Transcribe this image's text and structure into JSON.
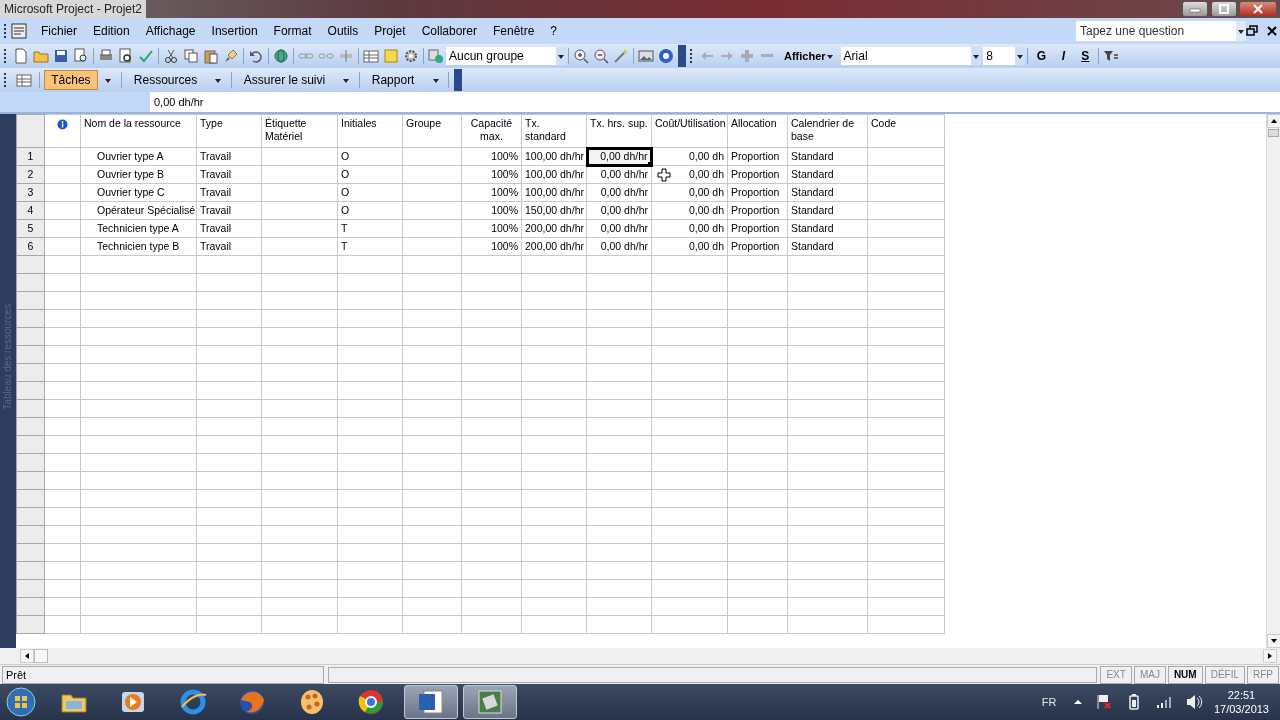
{
  "window": {
    "title": "Microsoft Project - Projet2"
  },
  "menu": [
    "Fichier",
    "Edition",
    "Affichage",
    "Insertion",
    "Format",
    "Outils",
    "Projet",
    "Collaborer",
    "Fenêtre",
    "?"
  ],
  "help_search": {
    "placeholder": "Tapez une question"
  },
  "toolbar": {
    "group_combo": "Aucun groupe",
    "show_menu": "Afficher",
    "font": "Arial",
    "font_size": "8",
    "format_buttons": [
      "G",
      "I",
      "S"
    ]
  },
  "view_bar": {
    "tabs": [
      {
        "label": "Tâches",
        "selected": true
      },
      {
        "label": "Ressources",
        "selected": false
      },
      {
        "label": "Assurer le suivi",
        "selected": false
      },
      {
        "label": "Rapport",
        "selected": false
      }
    ]
  },
  "entry_bar": {
    "value": "0,00 dh/hr"
  },
  "side_label": "Tableau des ressources",
  "table": {
    "columns": [
      {
        "kind": "icon"
      },
      {
        "kind": "text",
        "label": "Nom de la ressource"
      },
      {
        "kind": "text",
        "label": "Type"
      },
      {
        "kind": "text",
        "label": "Étiquette Matériel"
      },
      {
        "kind": "text",
        "label": "Initiales"
      },
      {
        "kind": "text",
        "label": "Groupe"
      },
      {
        "kind": "text",
        "label": "Capacité max."
      },
      {
        "kind": "text",
        "label": "Tx. standard"
      },
      {
        "kind": "text",
        "label": "Tx. hrs. sup."
      },
      {
        "kind": "text",
        "label": "Coût/Utilisation"
      },
      {
        "kind": "text",
        "label": "Allocation"
      },
      {
        "kind": "text",
        "label": "Calendrier de base"
      },
      {
        "kind": "text",
        "label": "Code"
      }
    ],
    "rows": [
      {
        "number": "1",
        "cells": [
          {
            "selected": false
          },
          {
            "text": "Ouvrier type A",
            "selected": false
          },
          {
            "text": "Travail",
            "selected": false
          },
          {
            "selected": false
          },
          {
            "text": "O",
            "selected": false
          },
          {
            "selected": false
          },
          {
            "text": "100%",
            "selected": false
          },
          {
            "text": "100,00 dh/hr",
            "selected": false
          },
          {
            "text": "0,00 dh/hr",
            "selected": true
          },
          {
            "text": "0,00 dh",
            "selected": false
          },
          {
            "text": "Proportion",
            "selected": false
          },
          {
            "text": "Standard",
            "selected": false
          },
          {
            "selected": false
          }
        ]
      },
      {
        "number": "2",
        "cells": [
          {
            "selected": false
          },
          {
            "text": "Ouvrier type B",
            "selected": false
          },
          {
            "text": "Travail",
            "selected": false
          },
          {
            "selected": false
          },
          {
            "text": "O",
            "selected": false
          },
          {
            "selected": false
          },
          {
            "text": "100%",
            "selected": false
          },
          {
            "text": "100,00 dh/hr",
            "selected": false
          },
          {
            "text": "0,00 dh/hr",
            "selected": false
          },
          {
            "text": "0,00 dh",
            "selected": false
          },
          {
            "text": "Proportion",
            "selected": false
          },
          {
            "text": "Standard",
            "selected": false
          },
          {
            "selected": false
          }
        ]
      },
      {
        "number": "3",
        "cells": [
          {
            "selected": false
          },
          {
            "text": "Ouvrier type C",
            "selected": false
          },
          {
            "text": "Travail",
            "selected": false
          },
          {
            "selected": false
          },
          {
            "text": "O",
            "selected": false
          },
          {
            "selected": false
          },
          {
            "text": "100%",
            "selected": false
          },
          {
            "text": "100,00 dh/hr",
            "selected": false
          },
          {
            "text": "0,00 dh/hr",
            "selected": false
          },
          {
            "text": "0,00 dh",
            "selected": false
          },
          {
            "text": "Proportion",
            "selected": false
          },
          {
            "text": "Standard",
            "selected": false
          },
          {
            "selected": false
          }
        ]
      },
      {
        "number": "4",
        "cells": [
          {
            "selected": false
          },
          {
            "text": "Opérateur Spécialisé",
            "selected": false
          },
          {
            "text": "Travail",
            "selected": false
          },
          {
            "selected": false
          },
          {
            "text": "O",
            "selected": false
          },
          {
            "selected": false
          },
          {
            "text": "100%",
            "selected": false
          },
          {
            "text": "150,00 dh/hr",
            "selected": false
          },
          {
            "text": "0,00 dh/hr",
            "selected": false
          },
          {
            "text": "0,00 dh",
            "selected": false
          },
          {
            "text": "Proportion",
            "selected": false
          },
          {
            "text": "Standard",
            "selected": false
          },
          {
            "selected": false
          }
        ]
      },
      {
        "number": "5",
        "cells": [
          {
            "selected": false
          },
          {
            "text": "Technicien type A",
            "selected": false
          },
          {
            "text": "Travail",
            "selected": false
          },
          {
            "selected": false
          },
          {
            "text": "T",
            "selected": false
          },
          {
            "selected": false
          },
          {
            "text": "100%",
            "selected": false
          },
          {
            "text": "200,00 dh/hr",
            "selected": false
          },
          {
            "text": "0,00 dh/hr",
            "selected": false
          },
          {
            "text": "0,00 dh",
            "selected": false
          },
          {
            "text": "Proportion",
            "selected": false
          },
          {
            "text": "Standard",
            "selected": false
          },
          {
            "selected": false
          }
        ]
      },
      {
        "number": "6",
        "cells": [
          {
            "selected": false
          },
          {
            "text": "Technicien type B",
            "selected": false
          },
          {
            "text": "Travail",
            "selected": false
          },
          {
            "selected": false
          },
          {
            "text": "T",
            "selected": false
          },
          {
            "selected": false
          },
          {
            "text": "100%",
            "selected": false
          },
          {
            "text": "200,00 dh/hr",
            "selected": false
          },
          {
            "text": "0,00 dh/hr",
            "selected": false
          },
          {
            "text": "0,00 dh",
            "selected": false
          },
          {
            "text": "Proportion",
            "selected": false
          },
          {
            "text": "Standard",
            "selected": false
          },
          {
            "selected": false
          }
        ]
      }
    ]
  },
  "status_bar": {
    "text": "Prêt",
    "indicators": [
      {
        "label": "EXT",
        "on": false
      },
      {
        "label": "MAJ",
        "on": false
      },
      {
        "label": "NUM",
        "on": true
      },
      {
        "label": "DÉFIL",
        "on": false
      },
      {
        "label": "RFP",
        "on": false
      }
    ]
  },
  "taskbar": {
    "apps": [
      {
        "kind": "folder",
        "active": false
      },
      {
        "kind": "media",
        "active": false
      },
      {
        "kind": "ring",
        "active": false
      },
      {
        "kind": "orb",
        "active": false
      },
      {
        "kind": "palette",
        "active": false
      },
      {
        "kind": "wheel",
        "active": false
      },
      {
        "kind": "document",
        "active": true
      },
      {
        "kind": "grid",
        "active": true
      }
    ],
    "language": "FR",
    "time": "22:51",
    "date": "17/03/2013"
  }
}
